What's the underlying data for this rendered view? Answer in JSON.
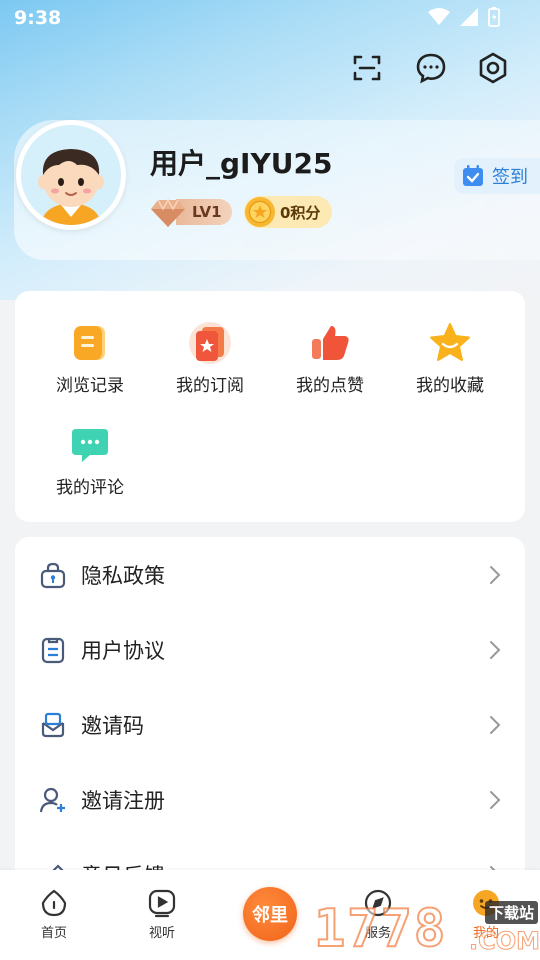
{
  "status_bar": {
    "time": "9:38"
  },
  "profile": {
    "username": "用户_gIYU25",
    "level": "LV1",
    "points": "0积分",
    "signin_label": "签到"
  },
  "quick_actions": [
    {
      "label": "浏览记录",
      "icon": "history-icon"
    },
    {
      "label": "我的订阅",
      "icon": "subscription-icon"
    },
    {
      "label": "我的点赞",
      "icon": "thumbs-up-icon"
    },
    {
      "label": "我的收藏",
      "icon": "star-icon"
    },
    {
      "label": "我的评论",
      "icon": "comment-icon"
    }
  ],
  "menu": [
    {
      "label": "隐私政策",
      "icon": "privacy-lock-icon"
    },
    {
      "label": "用户协议",
      "icon": "document-icon"
    },
    {
      "label": "邀请码",
      "icon": "mail-icon"
    },
    {
      "label": "邀请注册",
      "icon": "add-user-icon"
    },
    {
      "label": "意见反馈",
      "icon": "edit-icon"
    }
  ],
  "tabbar": {
    "home": "首页",
    "watch": "视听",
    "center": "邻里",
    "services": "服务",
    "mine": "我的"
  },
  "watermark": {
    "text": "1778",
    "sub": "下载站",
    "suffix": ".COM"
  },
  "colors": {
    "accent_orange": "#f0641a",
    "signin_blue": "#2b7fd6",
    "hero_blue": "#7cc8f2"
  }
}
